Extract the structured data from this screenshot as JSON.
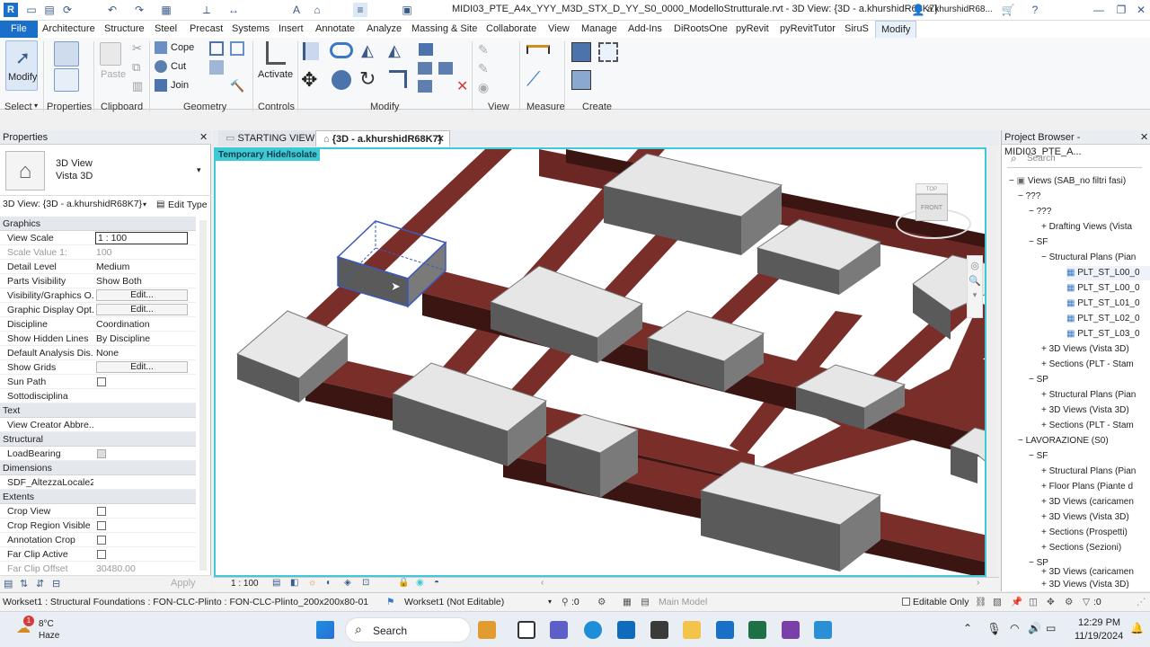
{
  "title": "MIDI03_PTE_A4x_YYY_M3D_STX_D_YY_S0_0000_ModelloStrutturale.rvt - 3D View: {3D - a.khurshidR68K7}",
  "user": "a.khurshidR68...",
  "tabs": [
    "File",
    "Architecture",
    "Structure",
    "Steel",
    "Precast",
    "Systems",
    "Insert",
    "Annotate",
    "Analyze",
    "Massing & Site",
    "Collaborate",
    "View",
    "Manage",
    "Add-Ins",
    "DiRootsOne",
    "pyRevit",
    "pyRevitTutor",
    "SiruS",
    "Modify"
  ],
  "ribbon": {
    "select": "Select",
    "select_modify": "Modify",
    "properties": "Properties",
    "clipboard": "Clipboard",
    "paste": "Paste",
    "geometry": "Geometry",
    "cope": "Cope",
    "cut": "Cut",
    "join": "Join",
    "controls": "Controls",
    "activate": "Activate",
    "modify": "Modify",
    "view": "View",
    "measure": "Measure",
    "create": "Create"
  },
  "properties": {
    "header": "Properties",
    "type_line1": "3D View",
    "type_line2": "Vista 3D",
    "instance": "3D View: {3D - a.khurshidR68K7}",
    "edit_type": "Edit Type",
    "sections": {
      "graphics": "Graphics",
      "text": "Text",
      "structural": "Structural",
      "dimensions": "Dimensions",
      "extents": "Extents"
    },
    "rows": {
      "view_scale": [
        "View Scale",
        "1 : 100"
      ],
      "scale_value": [
        "Scale Value    1:",
        "100"
      ],
      "detail_level": [
        "Detail Level",
        "Medium"
      ],
      "parts_visibility": [
        "Parts Visibility",
        "Show Both"
      ],
      "vg": [
        "Visibility/Graphics O...",
        "Edit..."
      ],
      "gdo": [
        "Graphic Display Opt...",
        "Edit..."
      ],
      "discipline": [
        "Discipline",
        "Coordination"
      ],
      "hidden_lines": [
        "Show Hidden Lines",
        "By Discipline"
      ],
      "analysis": [
        "Default Analysis Dis...",
        "None"
      ],
      "grids": [
        "Show Grids",
        "Edit..."
      ],
      "sun_path": [
        "Sun Path",
        ""
      ],
      "sottodisciplina": [
        "Sottodisciplina",
        ""
      ],
      "view_creator": [
        "View Creator Abbre...",
        ""
      ],
      "loadbearing": [
        "LoadBearing",
        ""
      ],
      "altezza": [
        "SDF_AltezzaLocale2",
        ""
      ],
      "crop_view": [
        "Crop View",
        ""
      ],
      "crop_region": [
        "Crop Region Visible",
        ""
      ],
      "annotation_crop": [
        "Annotation Crop",
        ""
      ],
      "far_clip": [
        "Far Clip Active",
        ""
      ],
      "far_clip_offset": [
        "Far Clip Offset",
        "30480.00"
      ]
    },
    "apply": "Apply"
  },
  "view_tabs": [
    "STARTING VIEW",
    "{3D - a.khurshidR68K7}"
  ],
  "viewport": {
    "banner": "Temporary Hide/Isolate",
    "cube_top": "TOP",
    "cube_front": "FRONT"
  },
  "view_scale": "1 : 100",
  "project_browser": {
    "header": "Project Browser - MIDI03_PTE_A...",
    "search": "Search",
    "items": [
      "Views (SAB_no filtri fasi)",
      "???",
      "???",
      "Drafting Views (Vista",
      "SF",
      "Structural Plans (Pian",
      "PLT_ST_L00_0",
      "PLT_ST_L00_0",
      "PLT_ST_L01_0",
      "PLT_ST_L02_0",
      "PLT_ST_L03_0",
      "3D Views (Vista 3D)",
      "Sections (PLT - Stam",
      "SP",
      "Structural Plans (Pian",
      "3D Views (Vista 3D)",
      "Sections (PLT - Stam",
      "LAVORAZIONE (S0)",
      "SF",
      "Structural Plans (Pian",
      "Floor Plans (Piante d",
      "3D Views (caricamen",
      "3D Views (Vista 3D)",
      "Sections (Prospetti)",
      "Sections (Sezioni)",
      "SP",
      "3D Views (caricamen",
      "3D Views (Vista 3D)"
    ]
  },
  "status": {
    "selection": "Workset1 : Structural Foundations : FON-CLC-Plinto : FON-CLC-Plinto_200x200x80-01",
    "workset": "Workset1 (Not Editable)",
    "zero": ":0",
    "main_model": "Main Model",
    "editable_only": "Editable Only",
    "filter_count": ":0"
  },
  "taskbar": {
    "temp": "8°C",
    "weather": "Haze",
    "search": "Search",
    "time": "12:29 PM",
    "date": "11/19/2024",
    "badge": "1"
  },
  "colors": {
    "beam": "#7a2e2a",
    "beam_dark": "#3a1512",
    "pile_top": "#e6e6e6",
    "pile_side": "#555555",
    "cyan": "#3ec9d6",
    "accent": "#1a6fc9"
  }
}
